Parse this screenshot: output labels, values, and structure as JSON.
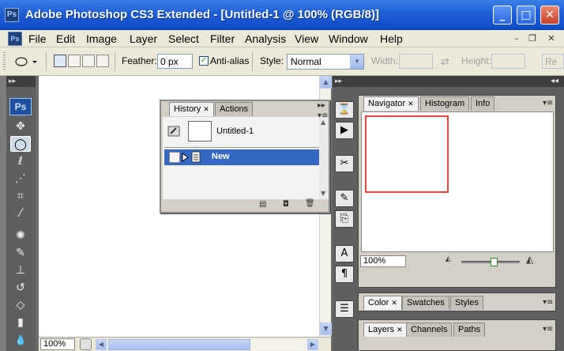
{
  "window": {
    "app_icon": "Ps",
    "title": "Adobe Photoshop CS3 Extended - [Untitled-1 @ 100% (RGB/8)]",
    "minimize_glyph": "_",
    "maximize_glyph": "□",
    "close_glyph": "✕"
  },
  "menubar": {
    "doc_icon": "Ps",
    "items": [
      "File",
      "Edit",
      "Image",
      "Layer",
      "Select",
      "Filter",
      "Analysis",
      "View",
      "Window",
      "Help"
    ],
    "mdi_minimize": "–",
    "mdi_restore": "❐",
    "mdi_close": "✕"
  },
  "options": {
    "feather_label": "Feather:",
    "feather_value": "0 px",
    "antialias_label": "Anti-alias",
    "antialias_checked": "✓",
    "style_label": "Style:",
    "style_value": "Normal",
    "width_label": "Width:",
    "height_label": "Height:",
    "refine_label": "Re",
    "swap_glyph": "⇄"
  },
  "toolbox": {
    "logo": "Ps",
    "collapse_glyph": "▸▸",
    "tools": [
      {
        "name": "move-tool",
        "glyph": "✥"
      },
      {
        "name": "marquee-tool",
        "glyph": "◯"
      },
      {
        "name": "lasso-tool",
        "glyph": "ℓ"
      },
      {
        "name": "magic-wand-tool",
        "glyph": "⋰"
      },
      {
        "name": "crop-tool",
        "glyph": "⌗"
      },
      {
        "name": "slice-tool",
        "glyph": "⁄"
      },
      {
        "name": "healing-tool",
        "glyph": "✺"
      },
      {
        "name": "brush-tool",
        "glyph": "✎"
      },
      {
        "name": "clone-stamp-tool",
        "glyph": "⊥"
      },
      {
        "name": "history-brush-tool",
        "glyph": "↺"
      },
      {
        "name": "eraser-tool",
        "glyph": "◇"
      },
      {
        "name": "gradient-tool",
        "glyph": "▮"
      },
      {
        "name": "blur-tool",
        "glyph": "💧"
      }
    ]
  },
  "document": {
    "zoom": "100%"
  },
  "history_panel": {
    "tabs": [
      "History",
      "Actions"
    ],
    "tab_close": "✕",
    "menu_glyph": "▾≡",
    "snapshot_label": "Untitled-1",
    "step_label": "New",
    "footer_icons": [
      "▤",
      "◘",
      "🗑"
    ]
  },
  "dock": {
    "collapse_glyph": "▸▸",
    "icons": [
      {
        "name": "history-dock-icon",
        "glyph": "⌛"
      },
      {
        "name": "actions-dock-icon",
        "glyph": "▶"
      },
      {
        "name": "tool-presets-dock-icon",
        "glyph": "✂"
      },
      {
        "name": "brushes-dock-icon",
        "glyph": "✎"
      },
      {
        "name": "clone-source-dock-icon",
        "glyph": "⎘"
      },
      {
        "name": "character-dock-icon",
        "glyph": "A"
      },
      {
        "name": "paragraph-dock-icon",
        "glyph": "¶"
      },
      {
        "name": "layer-comps-dock-icon",
        "glyph": "☰"
      }
    ]
  },
  "right_panels": {
    "collapse_glyph": "◂◂",
    "navigator_tabs": [
      "Navigator",
      "Histogram",
      "Info"
    ],
    "navigator_zoom": "100%",
    "color_tabs": [
      "Color",
      "Swatches",
      "Styles"
    ],
    "layers_tabs": [
      "Layers",
      "Channels",
      "Paths"
    ],
    "tab_close": "✕",
    "panel_menu_glyph": "▾≡",
    "zoom_out_glyph": "◭",
    "zoom_in_glyph": "◭",
    "navigator_slider_value": 0.55
  }
}
